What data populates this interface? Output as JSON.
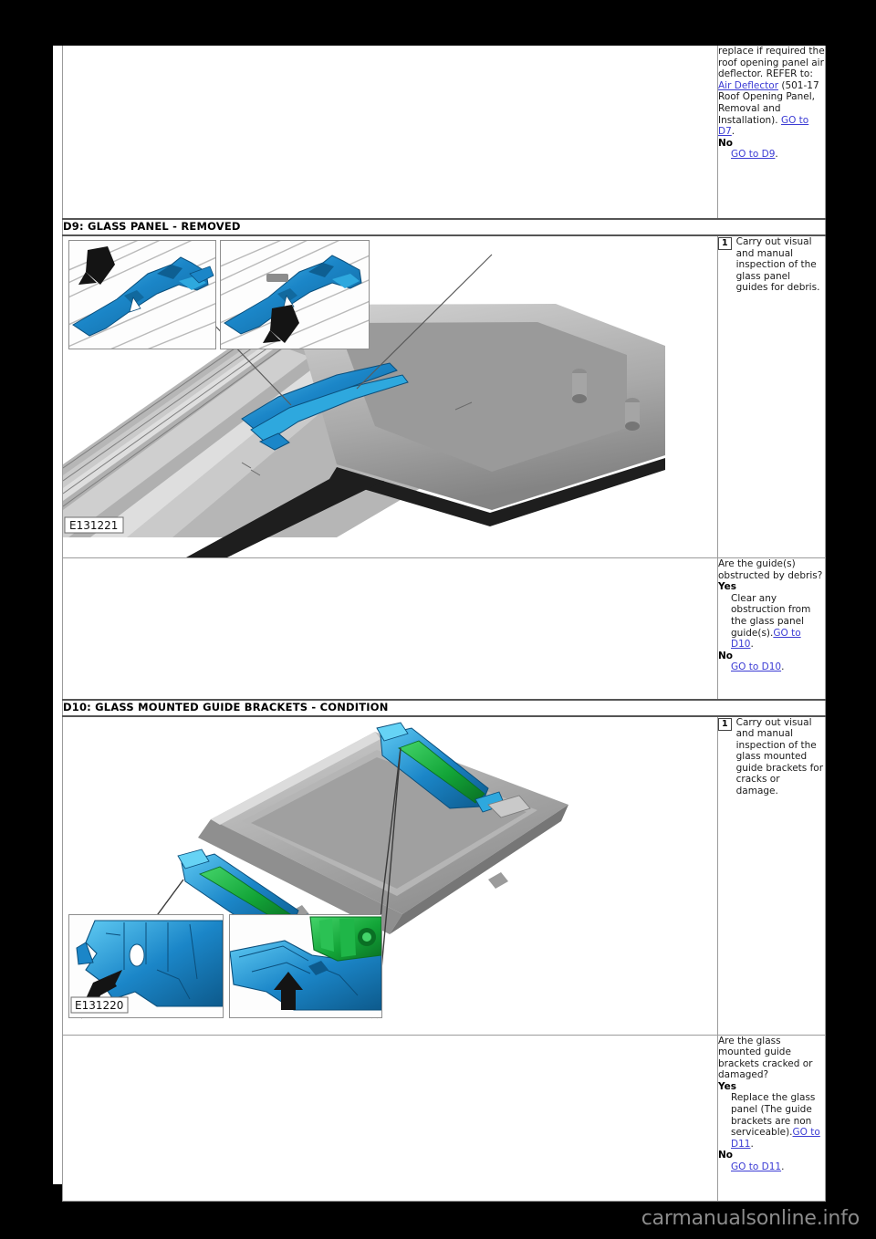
{
  "page": {
    "watermark": "carmanualsonline.info"
  },
  "rows": [
    {
      "id": "d8-continuation",
      "type": "result",
      "right": {
        "body_lines": [
          "replace if required the roof opening panel air deflector."
        ],
        "refer_prefix": "REFER to: ",
        "refer_link": "Air Deflector",
        "refer_suffix": " (501-17 Roof Opening Panel, Removal and Installation).",
        "yes_goto": "GO to D7",
        "no_label": "No",
        "no_goto": "GO to D9"
      }
    },
    {
      "id": "d9-header",
      "type": "section",
      "title": "D9: GLASS PANEL - REMOVED"
    },
    {
      "id": "d9-step",
      "type": "step",
      "step_number": "1",
      "step_text": "Carry out visual and manual inspection of the glass panel guides for debris.",
      "figure_label": "E131221"
    },
    {
      "id": "d9-result",
      "type": "result",
      "right": {
        "question": "Are the guide(s) obstructed by debris?",
        "yes_label": "Yes",
        "yes_text": "Clear any obstruction from the glass panel guide(s).",
        "yes_goto": "GO to D10",
        "no_label": "No",
        "no_goto": "GO to D10"
      }
    },
    {
      "id": "d10-header",
      "type": "section",
      "title": "D10: GLASS MOUNTED GUIDE BRACKETS - CONDITION"
    },
    {
      "id": "d10-step",
      "type": "step",
      "step_number": "1",
      "step_text": "Carry out visual and manual inspection of the glass mounted guide brackets for cracks or damage.",
      "figure_label": "E131220"
    },
    {
      "id": "d10-result",
      "type": "result",
      "right": {
        "question": "Are the glass mounted guide brackets cracked or damaged?",
        "yes_label": "Yes",
        "yes_text": "Replace the glass panel (The guide brackets are non serviceable).",
        "yes_goto": "GO to D11",
        "no_label": "No",
        "no_goto": "GO to D11"
      }
    }
  ],
  "colors": {
    "link": "#3b3bd4",
    "rule": "#9b9b9b",
    "part_blue": "#1b86c8",
    "part_green": "#13a538",
    "metal_light": "#cfcfcf",
    "metal_dark": "#6e6e6e",
    "arrow_black": "#141414"
  }
}
